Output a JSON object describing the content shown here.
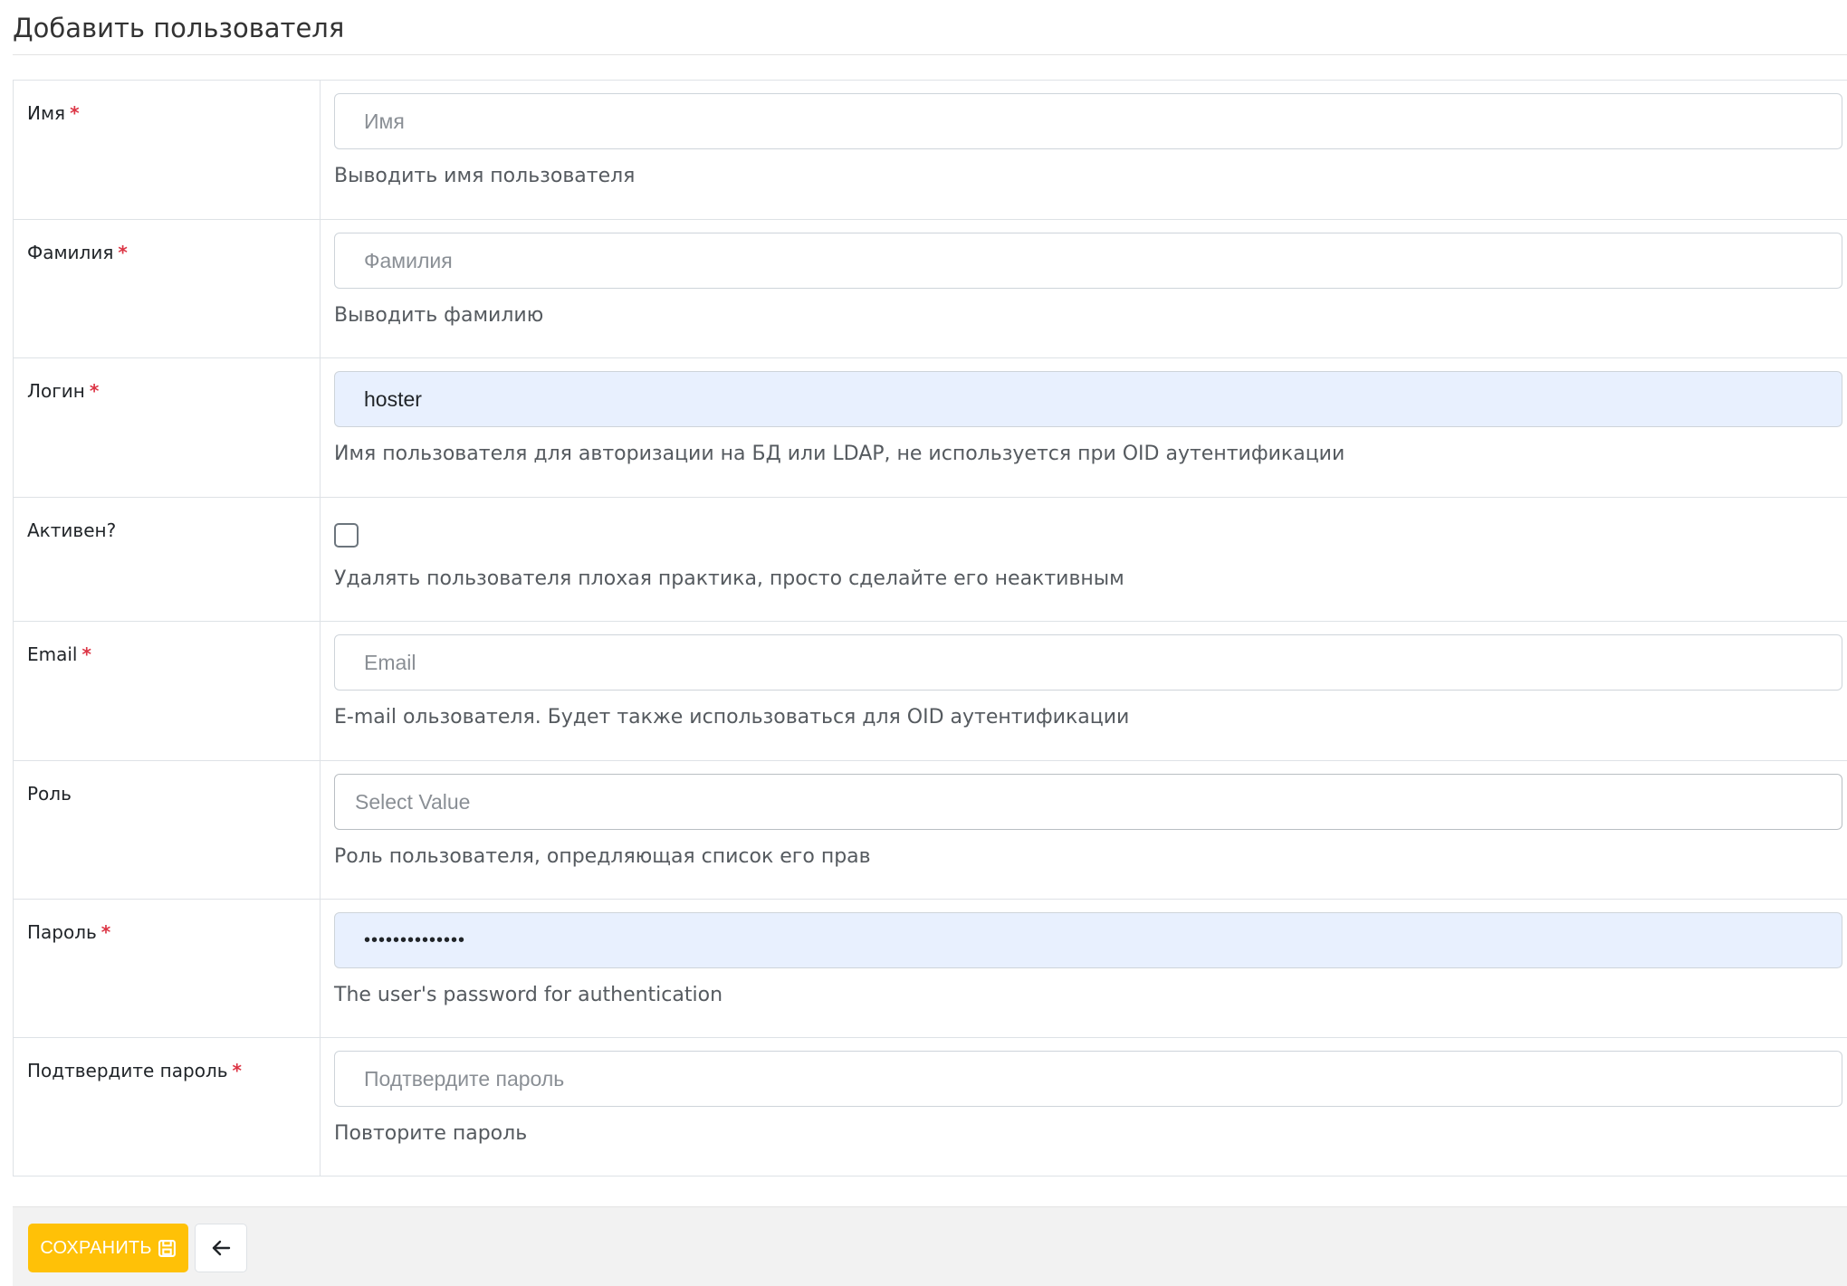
{
  "page": {
    "title": "Добавить пользователя"
  },
  "form": {
    "fields": [
      {
        "label": "Имя",
        "required": "*",
        "placeholder": "Имя",
        "value": "",
        "help": "Выводить имя пользователя"
      },
      {
        "label": "Фамилия",
        "required": "*",
        "placeholder": "Фамилия",
        "value": "",
        "help": "Выводить фамилию"
      },
      {
        "label": "Логин",
        "required": "*",
        "placeholder": "",
        "value": "hoster",
        "help": "Имя пользователя для авторизации на БД или LDAP, не используется при OID аутентификации"
      },
      {
        "label": "Активен?",
        "checked": false,
        "help": "Удалять пользователя плохая практика, просто сделайте его неактивным"
      },
      {
        "label": "Email",
        "required": "*",
        "placeholder": "Email",
        "value": "",
        "help": "E-mail ользователя. Будет также использоваться для OID аутентификации"
      },
      {
        "label": "Роль",
        "select_placeholder": "Select Value",
        "help": "Роль пользователя, опредляющая список его прав"
      },
      {
        "label": "Пароль",
        "required": "*",
        "placeholder": "",
        "value": "••••••••••••••",
        "help": "The user's password for authentication"
      },
      {
        "label": "Подтвердите пароль",
        "required": "*",
        "placeholder": "Подтвердите пароль",
        "value": "",
        "help": "Повторите пароль"
      }
    ]
  },
  "footer": {
    "save_label": "СОХРАНИТЬ",
    "save_icon": "floppy-disk-icon",
    "back_icon": "arrow-left-icon"
  },
  "colors": {
    "accent": "#ffc107",
    "required": "#dc3545",
    "autofill_bg": "#e8f0fe"
  }
}
